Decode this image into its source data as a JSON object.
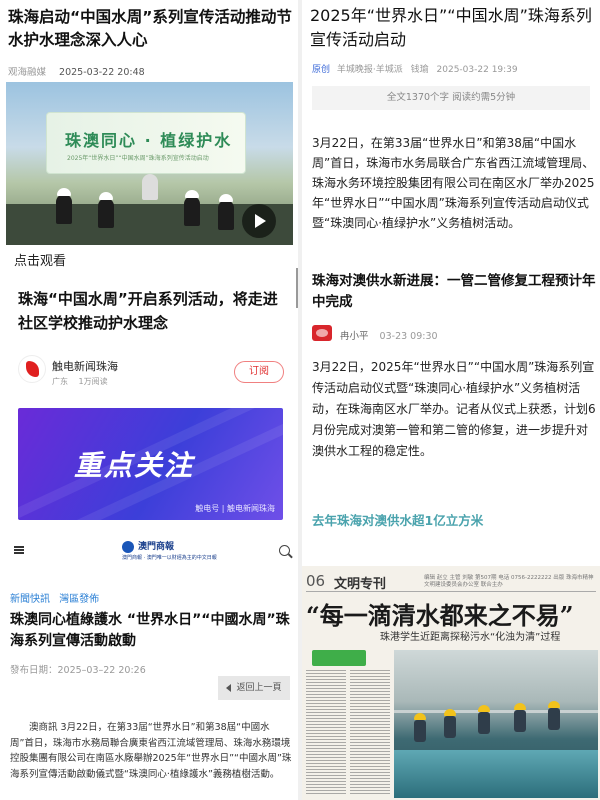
{
  "panel1": {
    "title": "珠海启动“中国水周”系列宣传活动推动节水护水理念深入人心",
    "source": "观海融媒",
    "date": "2025-03-22 20:48",
    "video": {
      "board_text": "珠澳同心 · 植绿护水",
      "board_sub": "2025年“世界水日”“中国水周”珠海系列宣传活动启动"
    },
    "click_watch": "点击观看",
    "sub_title": "珠海“中国水周”开启系列活动，将走进社区学校推动护水理念",
    "account_name": "触电新闻珠海",
    "account_region": "广东",
    "account_readers": "1万阅读",
    "follow_label": "订阅",
    "banner_text": "重点关注",
    "banner_tag": "触电号 | 触电新闻珠海",
    "paper_name": "澳門商報",
    "paper_small": "澳門商報 · 澳門唯一以財經為主的中文日報"
  },
  "panel2": {
    "title": "2025年“世界水日”“中国水周”珠海系列宣传活动启动",
    "original_badge": "原创",
    "byline": [
      "羊城晚报·羊城派",
      "钱瑜"
    ],
    "date": "2025-03-22 19:39",
    "fulltext_note": "全文1370个字 阅读约需5分钟",
    "body1": "3月22日，在第33届“世界水日”和第38届“中国水周”首日，珠海市水务局联合广东省西江流域管理局、珠海水务环境控股集团有限公司在南区水厂举办2025年“世界水日”“中国水周”珠海系列宣传活动启动仪式暨“珠澳同心·植绿护水”义务植树活动。",
    "sub_title": "珠海对澳供水新进展：一管二管修复工程预计年中完成",
    "author": "冉小平",
    "author_date": "03-23 09:30",
    "body2": "3月22日，2025年“世界水日”“中国水周”珠海系列宣传活动启动仪式暨“珠澳同心·植绿护水”义务植树活动，在珠海南区水厂举办。记者从仪式上获悉，计划6月份完成对澳第一管和第二管的修复，进一步提升对澳供水工程的稳定性。",
    "link_text": "去年珠海对澳供水超1亿立方米"
  },
  "panel3": {
    "categories": [
      "新聞快訊",
      "灣區發佈"
    ],
    "title": "珠澳同心植綠護水 “世界水日”“中國水周”珠海系列宣傳活動啟動",
    "date": "發布日期：2025–03–22 20:26",
    "back_label": "返回上一頁",
    "body": "澳商訊 3月22日，在第33屆“世界水日”和第38屆“中國水周”首日，珠海市水務局聯合廣東省西江流域管理局、珠海水務環境控股集團有限公司在南區水廠舉辦2025年“世界水日”“中國水周”珠海系列宣傳活動啟動儀式暨“珠澳同心·植綠護水”義務植樹活動。"
  },
  "panel4": {
    "page_num": "06",
    "section": "文明专刊",
    "meta": "编辑 赵立 主管 刘敏 第507期 电话 0756-2222222 出版 珠海市精神文明建设委员会办公室 联合主办",
    "headline": "“每一滴清水都来之不易”",
    "subhead": "珠港学生近距离探秘污水“化浊为清”过程"
  }
}
